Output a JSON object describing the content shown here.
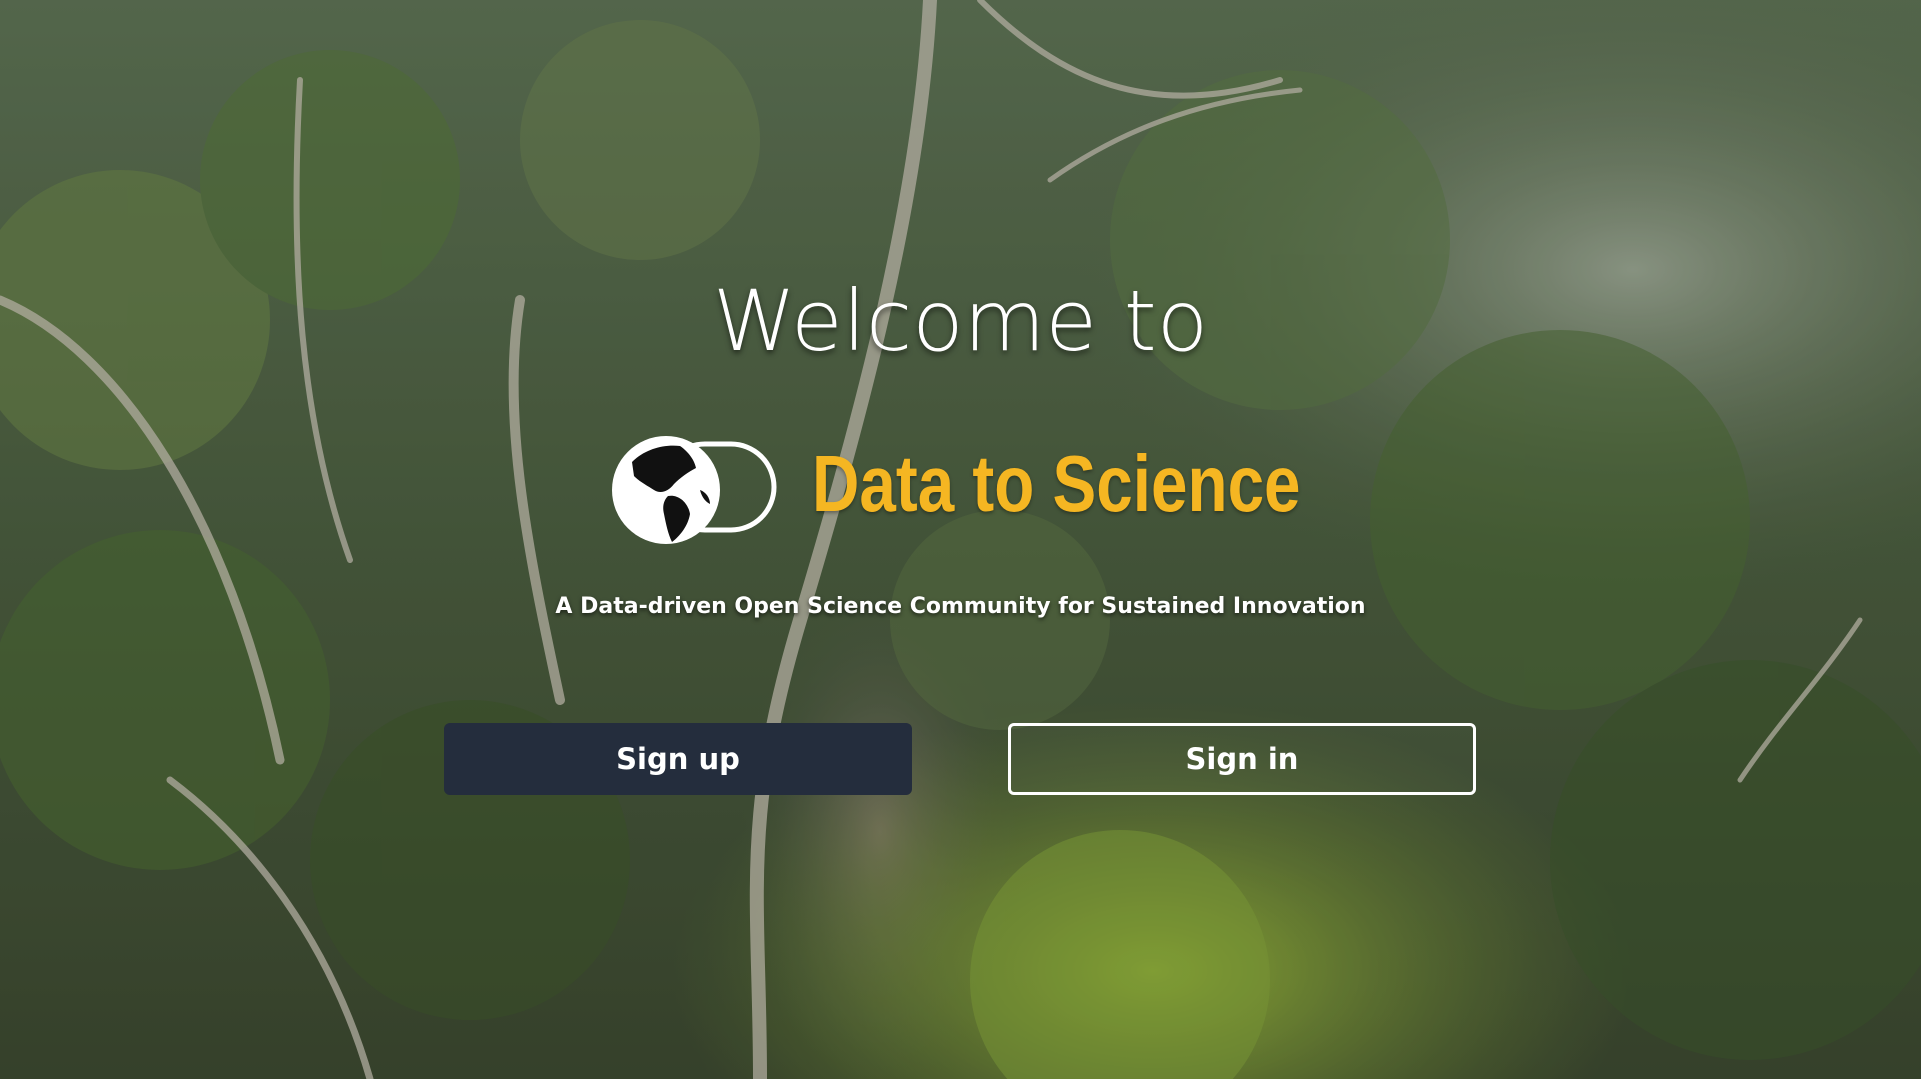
{
  "hero": {
    "welcome": "Welcome to",
    "brand": "Data to Science",
    "tagline": "A Data-driven Open Science Community for Sustained Innovation"
  },
  "actions": {
    "sign_up": "Sign up",
    "sign_in": "Sign in"
  },
  "colors": {
    "brand": "#f5b622",
    "primary_button": "#242d3d",
    "text": "#ffffff"
  },
  "icons": {
    "logo": "globe-toggle-logo"
  }
}
